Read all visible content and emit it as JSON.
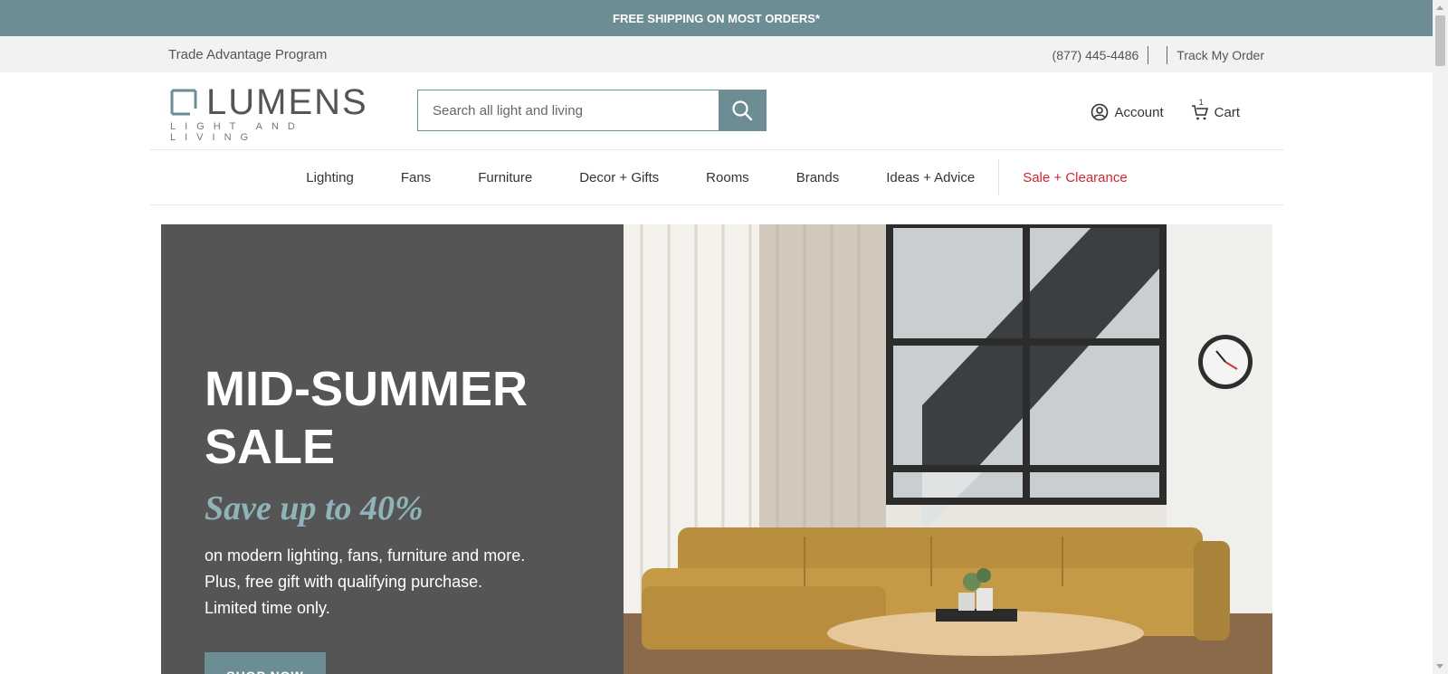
{
  "promo": {
    "text": "FREE SHIPPING ON MOST ORDERS*"
  },
  "utility": {
    "trade_link": "Trade Advantage Program",
    "phone": "(877) 445-4486",
    "track_order": "Track My Order"
  },
  "header": {
    "logo_word": "LUMENS",
    "logo_sub": "LIGHT AND LIVING",
    "search_placeholder": "Search all light and living",
    "account_label": "Account",
    "cart_label": "Cart",
    "cart_count": "1"
  },
  "nav": {
    "items": [
      "Lighting",
      "Fans",
      "Furniture",
      "Decor + Gifts",
      "Rooms",
      "Brands",
      "Ideas + Advice"
    ],
    "sale": "Sale + Clearance"
  },
  "hero": {
    "title": "MID-SUMMER SALE",
    "subtitle": "Save up to 40%",
    "body_line1": "on modern lighting, fans, furniture and more.",
    "body_line2": "Plus, free gift with qualifying purchase.",
    "body_line3": "Limited time only.",
    "cta": "SHOP NOW"
  },
  "colors": {
    "brand_teal": "#6b8d93",
    "sale_red": "#d1262d",
    "hero_panel": "#555555",
    "hero_accent": "#8fb3b8"
  },
  "icons": [
    "search-icon",
    "account-icon",
    "cart-icon"
  ]
}
